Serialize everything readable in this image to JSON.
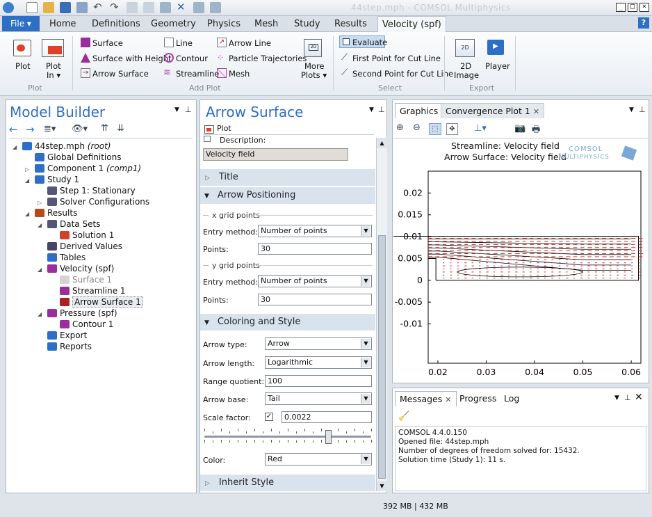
{
  "window": {
    "title": "44step.mph - COMSOL Multiphysics"
  },
  "menu": {
    "file": "File ▾",
    "tabs": [
      "Home",
      "Definitions",
      "Geometry",
      "Physics",
      "Mesh",
      "Study",
      "Results",
      "Velocity (spf)"
    ],
    "help": "?"
  },
  "ribbon": {
    "plot": "Plot",
    "plot_in": "Plot",
    "plot_in2": "In ▾",
    "group_plot": "Plot",
    "surface": "Surface",
    "surface_height": "Surface with Height",
    "arrow_surface": "Arrow Surface",
    "line": "Line",
    "contour": "Contour",
    "streamline": "Streamline",
    "arrow_line": "Arrow Line",
    "particle": "Particle Trajectories",
    "mesh": "Mesh",
    "more_plots": "More",
    "more_plots2": "Plots ▾",
    "group_add": "Add Plot",
    "evaluate": "Evaluate",
    "first_point": "First Point for Cut Line",
    "second_point": "Second Point for Cut Line",
    "group_select": "Select",
    "image2d": "2D",
    "image2d_2": "Image",
    "player": "Player",
    "group_export": "Export"
  },
  "model_builder": {
    "title": "Model Builder",
    "tree": [
      {
        "label": "44step.mph",
        "suffix": "(root)",
        "indent": 0
      },
      {
        "label": "Global Definitions",
        "indent": 1
      },
      {
        "label": "Component 1",
        "suffix": "(comp1)",
        "indent": 1
      },
      {
        "label": "Study 1",
        "indent": 1
      },
      {
        "label": "Step 1: Stationary",
        "indent": 2
      },
      {
        "label": "Solver Configurations",
        "indent": 2
      },
      {
        "label": "Results",
        "indent": 1
      },
      {
        "label": "Data Sets",
        "indent": 2
      },
      {
        "label": "Solution 1",
        "indent": 3
      },
      {
        "label": "Derived Values",
        "indent": 2
      },
      {
        "label": "Tables",
        "indent": 2
      },
      {
        "label": "Velocity (spf)",
        "indent": 2
      },
      {
        "label": "Surface 1",
        "indent": 3
      },
      {
        "label": "Streamline 1",
        "indent": 3
      },
      {
        "label": "Arrow Surface 1",
        "indent": 3
      },
      {
        "label": "Pressure (spf)",
        "indent": 2
      },
      {
        "label": "Contour 1",
        "indent": 3
      },
      {
        "label": "Export",
        "indent": 2
      },
      {
        "label": "Reports",
        "indent": 2
      }
    ]
  },
  "settings": {
    "title": "Arrow Surface",
    "plot_btn": "Plot",
    "description_label": "Description:",
    "description_value": "Velocity field",
    "sec_title": "Title",
    "sec_arrow_pos": "Arrow Positioning",
    "x_grid": "x grid points",
    "y_grid": "y grid points",
    "entry_method_label": "Entry method:",
    "entry_method_value": "Number of points",
    "points_label": "Points:",
    "x_points": "30",
    "y_points": "30",
    "sec_coloring": "Coloring and Style",
    "arrow_type_label": "Arrow type:",
    "arrow_type": "Arrow",
    "arrow_length_label": "Arrow length:",
    "arrow_length": "Logarithmic",
    "range_quotient_label": "Range quotient:",
    "range_quotient": "100",
    "arrow_base_label": "Arrow base:",
    "arrow_base": "Tail",
    "scale_factor_label": "Scale factor:",
    "scale_factor": "0.0022",
    "slider_level": 0.74,
    "color_label": "Color:",
    "color": "Red",
    "sec_inherit": "Inherit Style"
  },
  "graphics": {
    "tab_graphics": "Graphics",
    "tab_convergence": "Convergence Plot 1",
    "plot_title1": "Streamline: Velocity field",
    "plot_title2": "Arrow Surface: Velocity field",
    "logo1": "COMSOL",
    "logo2": "MULTIPHYSICS"
  },
  "chart_data": {
    "type": "line",
    "title": "",
    "xlim": [
      0.018,
      0.062
    ],
    "ylim": [
      -0.019,
      0.025
    ],
    "x_ticks": [
      "0.02",
      "0.03",
      "0.04",
      "0.05",
      "0.06"
    ],
    "y_ticks": [
      "0.02",
      "0.015",
      "0.01",
      "0.005",
      "0",
      "-0.005",
      "-0.01"
    ],
    "x_tick_values": [
      0.02,
      0.03,
      0.04,
      0.05,
      0.06
    ],
    "y_tick_values": [
      0.02,
      0.015,
      0.01,
      0.005,
      0,
      -0.005,
      -0.01
    ],
    "grid": false
  },
  "messages": {
    "tab_messages": "Messages",
    "tab_progress": "Progress",
    "tab_log": "Log",
    "lines": [
      "COMSOL 4.4.0.150",
      "Opened file: 44step.mph",
      "Number of degrees of freedom solved for: 15432.",
      "Solution time (Study 1): 11 s."
    ]
  },
  "status": {
    "memory": "392 MB | 432 MB"
  },
  "colors": {
    "accent": "#2d6fc6",
    "arrow": "#cc1b1b",
    "section": "#d8e3ee"
  }
}
